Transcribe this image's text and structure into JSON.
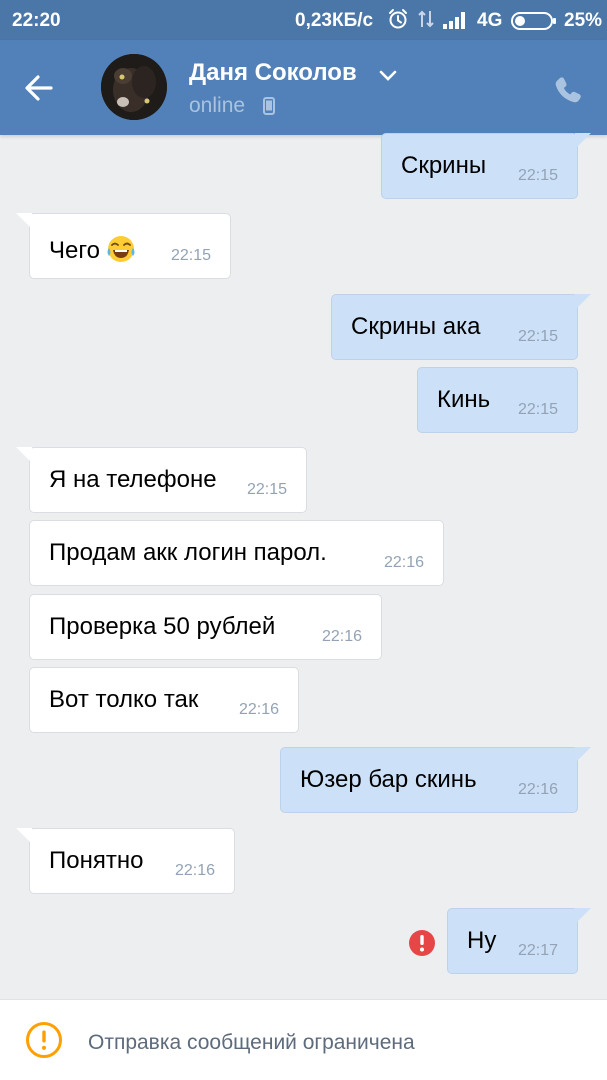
{
  "status_bar": {
    "time": "22:20",
    "network_speed": "0,23КБ/с",
    "network_type": "4G",
    "battery": "25%",
    "icons": [
      "alarm-icon",
      "data-transfer-icon",
      "signal-icon",
      "battery-icon"
    ]
  },
  "header": {
    "contact_name": "Даня Соколов",
    "status": "online",
    "icons": [
      "back-arrow-icon",
      "chevron-down-icon",
      "mobile-icon",
      "phone-icon"
    ],
    "background_color": "#5181b8"
  },
  "messages": [
    {
      "direction": "outgoing",
      "text": "Скрины",
      "time": "22:15"
    },
    {
      "direction": "incoming",
      "text": "Чего",
      "emoji": "laughing-crying-emoji",
      "time": "22:15"
    },
    {
      "direction": "outgoing",
      "text": "Скрины ака",
      "time": "22:15"
    },
    {
      "direction": "outgoing",
      "text": "Кинь",
      "time": "22:15"
    },
    {
      "direction": "incoming",
      "text": "Я на телефоне",
      "time": "22:15"
    },
    {
      "direction": "incoming",
      "text": "Продам акк логин парол.",
      "time": "22:16"
    },
    {
      "direction": "incoming",
      "text": "Проверка 50 рублей",
      "time": "22:16"
    },
    {
      "direction": "incoming",
      "text": "Вот толко так",
      "time": "22:16"
    },
    {
      "direction": "outgoing",
      "text": "Юзер бар скинь",
      "time": "22:16"
    },
    {
      "direction": "incoming",
      "text": "Понятно",
      "time": "22:16"
    },
    {
      "direction": "outgoing",
      "text": "Ну",
      "time": "22:17",
      "status": "failed-to-send"
    }
  ],
  "bottom_bar": {
    "text": "Отправка сообщений ограничена",
    "icon": "warning-icon"
  },
  "colors": {
    "accent": "#5181b8",
    "incoming_bubble": "#ffffff",
    "outgoing_bubble": "#cce0f8",
    "error": "#e64646",
    "warning": "#ffa000",
    "background": "#edeef0"
  }
}
